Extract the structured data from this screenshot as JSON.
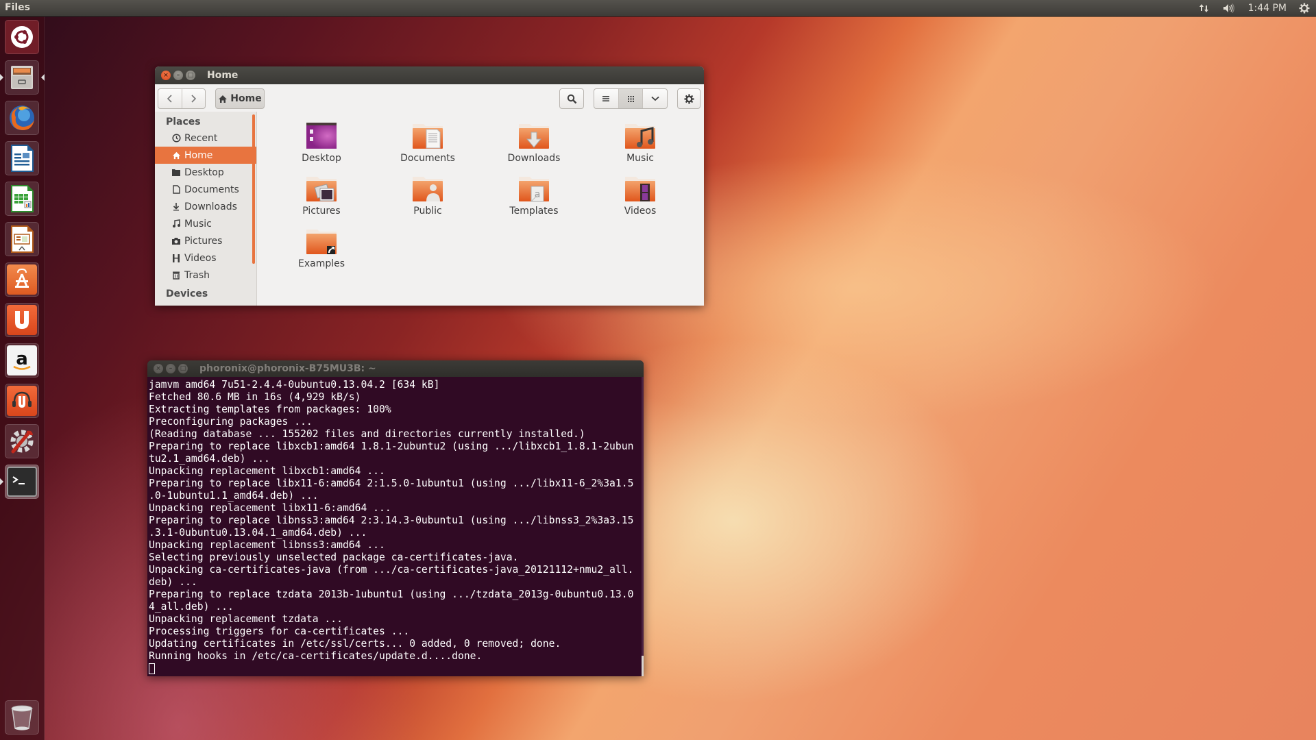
{
  "top_panel": {
    "app_title": "Files",
    "indicators": [
      {
        "name": "network-icon"
      },
      {
        "name": "volume-icon"
      },
      {
        "name": "clock",
        "text": "1:44 PM"
      },
      {
        "name": "session-gear-icon"
      }
    ]
  },
  "launcher": {
    "items": [
      {
        "name": "dash-home",
        "icon": "ubuntu-logo-icon"
      },
      {
        "name": "files",
        "icon": "file-cabinet-icon",
        "running": true,
        "focused": true
      },
      {
        "name": "firefox",
        "icon": "firefox-icon"
      },
      {
        "name": "libreoffice-writer",
        "icon": "writer-icon"
      },
      {
        "name": "libreoffice-calc",
        "icon": "calc-icon"
      },
      {
        "name": "libreoffice-impress",
        "icon": "impress-icon"
      },
      {
        "name": "ubuntu-software-center",
        "icon": "software-center-icon"
      },
      {
        "name": "ubuntu-one",
        "icon": "ubuntu-one-icon"
      },
      {
        "name": "amazon",
        "icon": "amazon-icon"
      },
      {
        "name": "ubuntu-one-music",
        "icon": "ubuntu-one-music-icon"
      },
      {
        "name": "system-settings",
        "icon": "settings-wrench-icon"
      },
      {
        "name": "terminal",
        "icon": "terminal-icon",
        "running": true
      },
      {
        "name": "trash",
        "icon": "trash-icon"
      }
    ]
  },
  "files_window": {
    "title": "Home",
    "path_button": "Home",
    "sidebar": {
      "places_heading": "Places",
      "items": [
        {
          "label": "Recent",
          "icon": "clock-icon"
        },
        {
          "label": "Home",
          "icon": "home-icon",
          "active": true
        },
        {
          "label": "Desktop",
          "icon": "folder-icon"
        },
        {
          "label": "Documents",
          "icon": "document-icon"
        },
        {
          "label": "Downloads",
          "icon": "download-icon"
        },
        {
          "label": "Music",
          "icon": "music-icon"
        },
        {
          "label": "Pictures",
          "icon": "camera-icon"
        },
        {
          "label": "Videos",
          "icon": "film-icon"
        },
        {
          "label": "Trash",
          "icon": "trash-icon"
        }
      ],
      "devices_heading": "Devices"
    },
    "files": [
      {
        "label": "Desktop",
        "icon": "desktop-folder-icon"
      },
      {
        "label": "Documents",
        "icon": "documents-folder-icon"
      },
      {
        "label": "Downloads",
        "icon": "downloads-folder-icon"
      },
      {
        "label": "Music",
        "icon": "music-folder-icon"
      },
      {
        "label": "Pictures",
        "icon": "pictures-folder-icon"
      },
      {
        "label": "Public",
        "icon": "public-folder-icon"
      },
      {
        "label": "Templates",
        "icon": "templates-folder-icon"
      },
      {
        "label": "Videos",
        "icon": "videos-folder-icon"
      },
      {
        "label": "Examples",
        "icon": "examples-link-folder-icon"
      }
    ],
    "view_mode": "icons"
  },
  "terminal_window": {
    "title": "phoronix@phoronix-B75MU3B: ~",
    "lines": [
      "jamvm amd64 7u51-2.4.4-0ubuntu0.13.04.2 [634 kB]",
      "Fetched 80.6 MB in 16s (4,929 kB/s)",
      "Extracting templates from packages: 100%",
      "Preconfiguring packages ...",
      "(Reading database ... 155202 files and directories currently installed.)",
      "Preparing to replace libxcb1:amd64 1.8.1-2ubuntu2 (using .../libxcb1_1.8.1-2ubun",
      "tu2.1_amd64.deb) ...",
      "Unpacking replacement libxcb1:amd64 ...",
      "Preparing to replace libx11-6:amd64 2:1.5.0-1ubuntu1 (using .../libx11-6_2%3a1.5",
      ".0-1ubuntu1.1_amd64.deb) ...",
      "Unpacking replacement libx11-6:amd64 ...",
      "Preparing to replace libnss3:amd64 2:3.14.3-0ubuntu1 (using .../libnss3_2%3a3.15",
      ".3.1-0ubuntu0.13.04.1_amd64.deb) ...",
      "Unpacking replacement libnss3:amd64 ...",
      "Selecting previously unselected package ca-certificates-java.",
      "Unpacking ca-certificates-java (from .../ca-certificates-java_20121112+nmu2_all.",
      "deb) ...",
      "Preparing to replace tzdata 2013b-1ubuntu1 (using .../tzdata_2013g-0ubuntu0.13.0",
      "4_all.deb) ...",
      "Unpacking replacement tzdata ...",
      "Processing triggers for ca-certificates ...",
      "Updating certificates in /etc/ssl/certs... 0 added, 0 removed; done.",
      "Running hooks in /etc/ca-certificates/update.d....done."
    ]
  },
  "colors": {
    "accent_orange": "#e8743f",
    "terminal_bg": "#300a24",
    "panel_bg": "#3c3b37"
  }
}
